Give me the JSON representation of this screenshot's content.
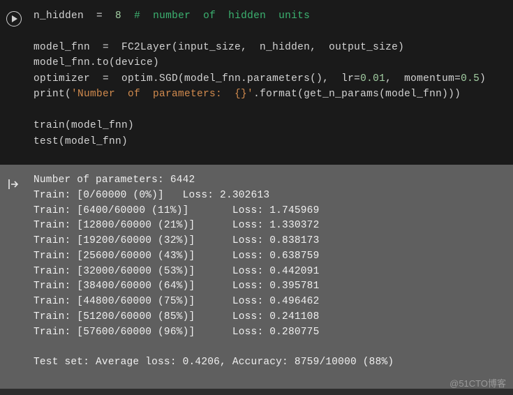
{
  "code": {
    "line1": {
      "var": "n_hidden",
      "eq": "  =  ",
      "num": "8",
      "sp": "  ",
      "comment": "#  number  of  hidden  units"
    },
    "line2": {
      "var": "model_fnn",
      "eq": "  =  ",
      "call": "FC2Layer(input_size,  n_hidden,  output_size)"
    },
    "line3": {
      "text": "model_fnn.to(device)"
    },
    "line4": {
      "var": "optimizer",
      "eq": "  =  ",
      "call": "optim.SGD(model_fnn.parameters(),  lr=",
      "num1": "0.01",
      "mid": ",  momentum=",
      "num2": "0.5",
      "end": ")"
    },
    "line5": {
      "pre": "print(",
      "str": "'Number  of  parameters:  {}'",
      "post": ".format(get_n_params(model_fnn)))"
    },
    "line6": {
      "text": "train(model_fnn)"
    },
    "line7": {
      "text": "test(model_fnn)"
    }
  },
  "output": {
    "l1": "Number of parameters: 6442",
    "l2": "Train: [0/60000 (0%)]   Loss: 2.302613",
    "l3": "Train: [6400/60000 (11%)]       Loss: 1.745969",
    "l4": "Train: [12800/60000 (21%)]      Loss: 1.330372",
    "l5": "Train: [19200/60000 (32%)]      Loss: 0.838173",
    "l6": "Train: [25600/60000 (43%)]      Loss: 0.638759",
    "l7": "Train: [32000/60000 (53%)]      Loss: 0.442091",
    "l8": "Train: [38400/60000 (64%)]      Loss: 0.395781",
    "l9": "Train: [44800/60000 (75%)]      Loss: 0.496462",
    "l10": "Train: [51200/60000 (85%)]      Loss: 0.241108",
    "l11": "Train: [57600/60000 (96%)]      Loss: 0.280775",
    "l12": "",
    "l13": "Test set: Average loss: 0.4206, Accuracy: 8759/10000 (88%)"
  },
  "watermark": "@51CTO博客"
}
